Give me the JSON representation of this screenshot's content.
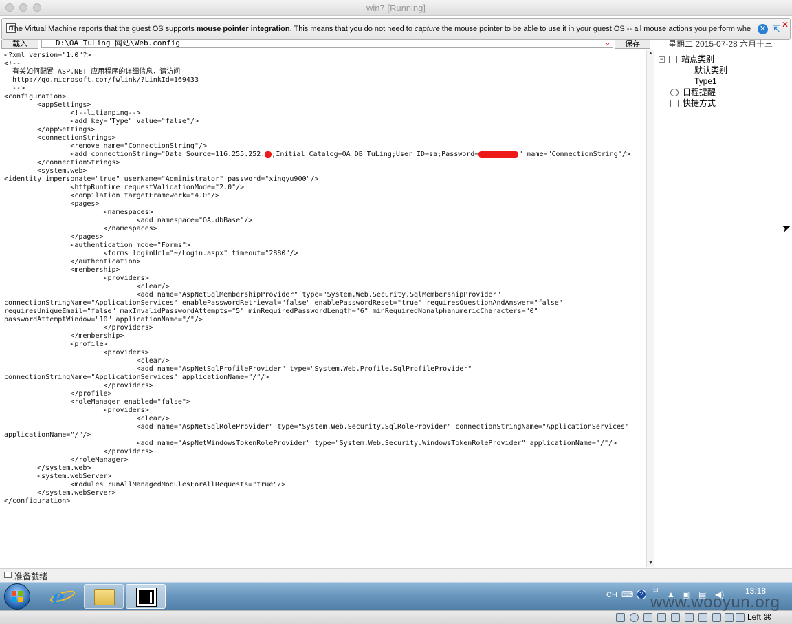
{
  "window": {
    "title": "win7 [Running]"
  },
  "notification": {
    "text_part1": "The Virtual Machine reports that the guest OS supports ",
    "text_bold": "mouse pointer integration",
    "text_part2": ". This means that you do not need to ",
    "text_italic": "capture",
    "text_part3": " the mouse pointer to be able to use it in your guest OS -- all mouse actions you perform when"
  },
  "toolbar": {
    "load_label": "载入",
    "path_value": "D:\\OA_TuLing_网站\\Web.config",
    "save_label": "保存"
  },
  "right_panel": {
    "date": "星期二  2015-07-28  六月十三",
    "tree": {
      "root": "站点类别",
      "children": [
        "默认类别",
        "Type1"
      ],
      "schedule": "日程提醒",
      "shortcut": "快捷方式"
    }
  },
  "code_lines": [
    "<?xml version=\"1.0\"?>",
    "<!--",
    "  有关如何配置 ASP.NET 应用程序的详细信息，请访问",
    "  http://go.microsoft.com/fwlink/?LinkId=169433",
    "  -->",
    "<configuration>",
    "        <appSettings>",
    "                <!--litianping-->",
    "                <add key=\"Type\" value=\"false\"/>",
    "        </appSettings>",
    "        <connectionStrings>",
    "                <remove name=\"ConnectionString\"/>",
    "                <add connectionString=\"Data Source=116.255.252.",
    "        </connectionStrings>",
    "        <system.web>",
    "<identity impersonate=\"true\" userName=\"Administrator\" password=\"xingyu900\"/>",
    "                <httpRuntime requestValidationMode=\"2.0\"/>",
    "                <compilation targetFramework=\"4.0\"/>",
    "                <pages>",
    "                        <namespaces>",
    "                                <add namespace=\"OA.dbBase\"/>",
    "                        </namespaces>",
    "                </pages>",
    "                <authentication mode=\"Forms\">",
    "                        <forms loginUrl=\"~/Login.aspx\" timeout=\"2880\"/>",
    "                </authentication>",
    "                <membership>",
    "                        <providers>",
    "                                <clear/>",
    "                                <add name=\"AspNetSqlMembershipProvider\" type=\"System.Web.Security.SqlMembershipProvider\"",
    "connectionStringName=\"ApplicationServices\" enablePasswordRetrieval=\"false\" enablePasswordReset=\"true\" requiresQuestionAndAnswer=\"false\"",
    "requiresUniqueEmail=\"false\" maxInvalidPasswordAttempts=\"5\" minRequiredPasswordLength=\"6\" minRequiredNonalphanumericCharacters=\"0\"",
    "passwordAttemptWindow=\"10\" applicationName=\"/\"/>",
    "                        </providers>",
    "                </membership>",
    "                <profile>",
    "                        <providers>",
    "                                <clear/>",
    "                                <add name=\"AspNetSqlProfileProvider\" type=\"System.Web.Profile.SqlProfileProvider\"",
    "connectionStringName=\"ApplicationServices\" applicationName=\"/\"/>",
    "                        </providers>",
    "                </profile>",
    "                <roleManager enabled=\"false\">",
    "                        <providers>",
    "                                <clear/>",
    "                                <add name=\"AspNetSqlRoleProvider\" type=\"System.Web.Security.SqlRoleProvider\" connectionStringName=\"ApplicationServices\"",
    "applicationName=\"/\"/>",
    "                                <add name=\"AspNetWindowsTokenRoleProvider\" type=\"System.Web.Security.WindowsTokenRoleProvider\" applicationName=\"/\"/>",
    "                        </providers>",
    "                </roleManager>",
    "        </system.web>",
    "        <system.webServer>",
    "                <modules runAllManagedModulesForAllRequests=\"true\"/>",
    "        </system.webServer>",
    "</configuration>"
  ],
  "connection_line": {
    "mid": ";Initial Catalog=OA_DB_TuLing;User ID=sa;Password=",
    "tail": "\" name=\"ConnectionString\"/>"
  },
  "status": {
    "text": "准备就绪"
  },
  "taskbar": {
    "lang": "CH",
    "time": "13:18"
  },
  "vbox_status": {
    "host_key": "Left ⌘"
  },
  "watermark": "www.wooyun.org",
  "colors": {
    "redaction": "#ee1a1a",
    "accent_blue": "#2a7fd4"
  }
}
